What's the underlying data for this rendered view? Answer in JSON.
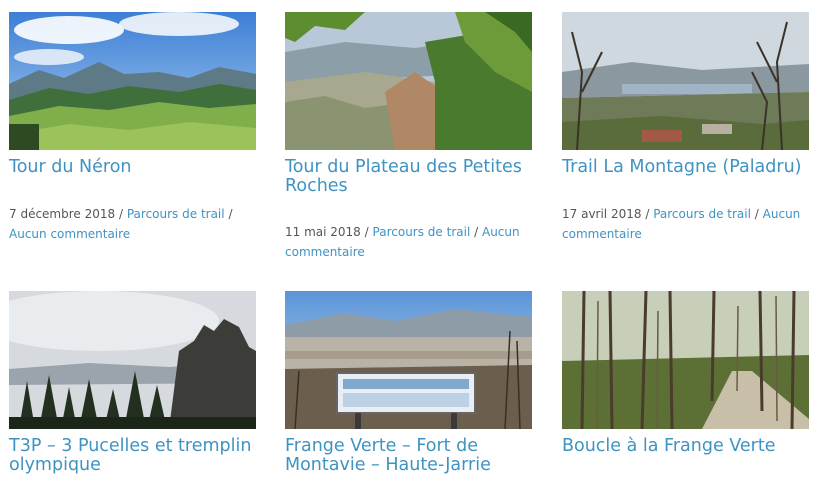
{
  "posts": [
    {
      "title": "Tour du Néron",
      "date": "7 décembre 2018",
      "category": "Parcours de trail",
      "comments": "Aucun commentaire",
      "image": "mountain-meadow-photo"
    },
    {
      "title": "Tour du Plateau des Petites Roches",
      "date": "11 mai 2018",
      "category": "Parcours de trail",
      "comments": "Aucun commentaire",
      "image": "cliff-valley-photo"
    },
    {
      "title": "Trail La Montagne (Paladru)",
      "date": "17 avril 2018",
      "category": "Parcours de trail",
      "comments": "Aucun commentaire",
      "image": "lake-village-photo"
    },
    {
      "title": "T3P – 3 Pucelles et tremplin olympique",
      "image": "rock-peaks-forest-photo"
    },
    {
      "title": "Frange Verte – Fort de Montavie – Haute-Jarrie",
      "image": "city-panorama-sign-photo"
    },
    {
      "title": "Boucle à la Frange Verte",
      "image": "forest-path-photo"
    }
  ],
  "separator": "/"
}
